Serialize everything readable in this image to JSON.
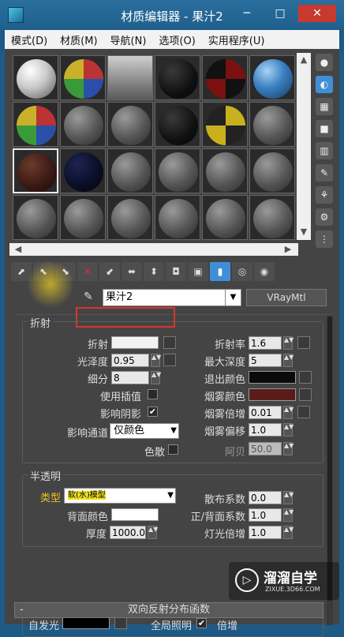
{
  "window": {
    "title": "材质编辑器 - 果汁2",
    "min": "─",
    "max": "□",
    "close": "✕"
  },
  "menu": [
    "模式(D)",
    "材质(M)",
    "导航(N)",
    "选项(O)",
    "实用程序(U)"
  ],
  "sidetools": [
    "●",
    "◐",
    "▦",
    "■",
    "▥",
    "✎",
    "⚘",
    "⚙",
    "⋮"
  ],
  "toolbar": [
    "⬈",
    "⬉",
    "⬊",
    "✕",
    "⬋",
    "⬌",
    "⬍",
    "◘",
    "▣",
    "▮",
    "◎",
    "◉"
  ],
  "material": {
    "name": "果汁2",
    "type": "VRayMtl"
  },
  "refraction": {
    "title": "折射",
    "refract_label": "折射",
    "refract_color": "#f2f2f2",
    "glossiness_label": "光泽度",
    "glossiness": "0.95",
    "subdivs_label": "细分",
    "subdivs": "8",
    "use_interp_label": "使用插值",
    "affect_shadows_label": "影响阴影",
    "affect_shadows": "✔",
    "affect_channels_label": "影响通道",
    "affect_channels": "仅颜色",
    "dispersion_label": "色散",
    "ior_label": "折射率",
    "ior": "1.6",
    "max_depth_label": "最大深度",
    "max_depth": "5",
    "exit_color_label": "退出颜色",
    "exit_color": "#0a0a0a",
    "fog_color_label": "烟雾颜色",
    "fog_color": "#5a1c18",
    "fog_mult_label": "烟雾倍增",
    "fog_mult": "0.01",
    "fog_bias_label": "烟雾偏移",
    "fog_bias": "1.0",
    "abbe_label": "阿贝",
    "abbe": "50.0"
  },
  "translucency": {
    "title": "半透明",
    "type_label": "类型",
    "type_value": "软(水)模型",
    "back_color_label": "背面颜色",
    "back_color": "#ffffff",
    "thickness_label": "厚度",
    "thickness": "1000.0",
    "scatter_label": "散布系数",
    "scatter": "0.0",
    "fb_label": "正/背面系数",
    "fb": "1.0",
    "light_mult_label": "灯光倍增",
    "light_mult": "1.0"
  },
  "self_illum": {
    "title": "自发光",
    "label": "自发光",
    "color": "#000000",
    "gi_label": "全局照明",
    "gi": "✔",
    "mult_label": "倍增"
  },
  "brdf": {
    "toggle": "-",
    "title": "双向反射分布函数"
  },
  "watermark": {
    "icon": "▷",
    "text": "溜溜自学",
    "sub": "ZIXUE.3D66.COM"
  }
}
